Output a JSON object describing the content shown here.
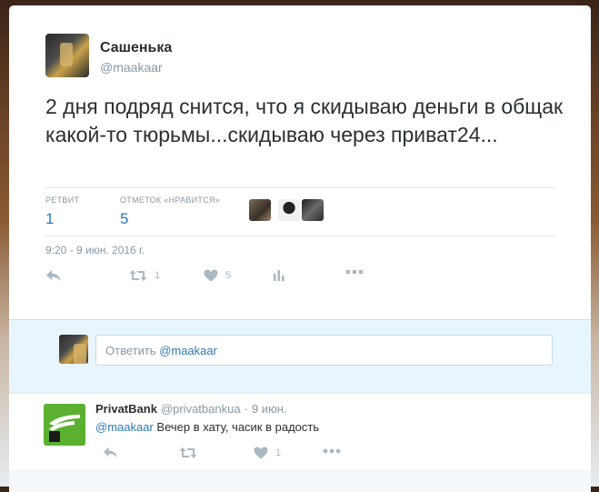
{
  "tweet": {
    "author_name": "Сашенька",
    "author_handle": "@maakaar",
    "text": "2 дня подряд снится, что я скидываю деньги в общак какой-то тюрьмы...скидываю через приват24...",
    "stats": {
      "retweets_label": "РЕТВИТ",
      "retweets_value": "1",
      "likes_label": "ОТМЕТОК «НРАВИТСЯ»",
      "likes_value": "5"
    },
    "timestamp": "9:20 - 9 июн. 2016 г.",
    "actions": {
      "reply_icon": "reply-icon",
      "retweet_icon": "retweet-icon",
      "retweet_count": "1",
      "like_icon": "heart-icon",
      "like_count": "5",
      "analytics_icon": "analytics-icon",
      "more_icon": "more-icon"
    }
  },
  "reply_box": {
    "placeholder_prefix": "Ответить ",
    "placeholder_mention": "@maakaar"
  },
  "reply": {
    "author_name": "PrivatBank",
    "author_handle": "@privatbankua",
    "separator": "·",
    "time": "9 июн.",
    "mention": "@maakaar",
    "text": " Вечер в хату, часик в радость",
    "retweet_count": "",
    "like_count": "1"
  },
  "colors": {
    "accent": "#2b7bb9",
    "muted": "#8899a6",
    "text": "#292f33",
    "reply_bg": "#e8f5fd",
    "privatbank_green": "#5cb030"
  }
}
